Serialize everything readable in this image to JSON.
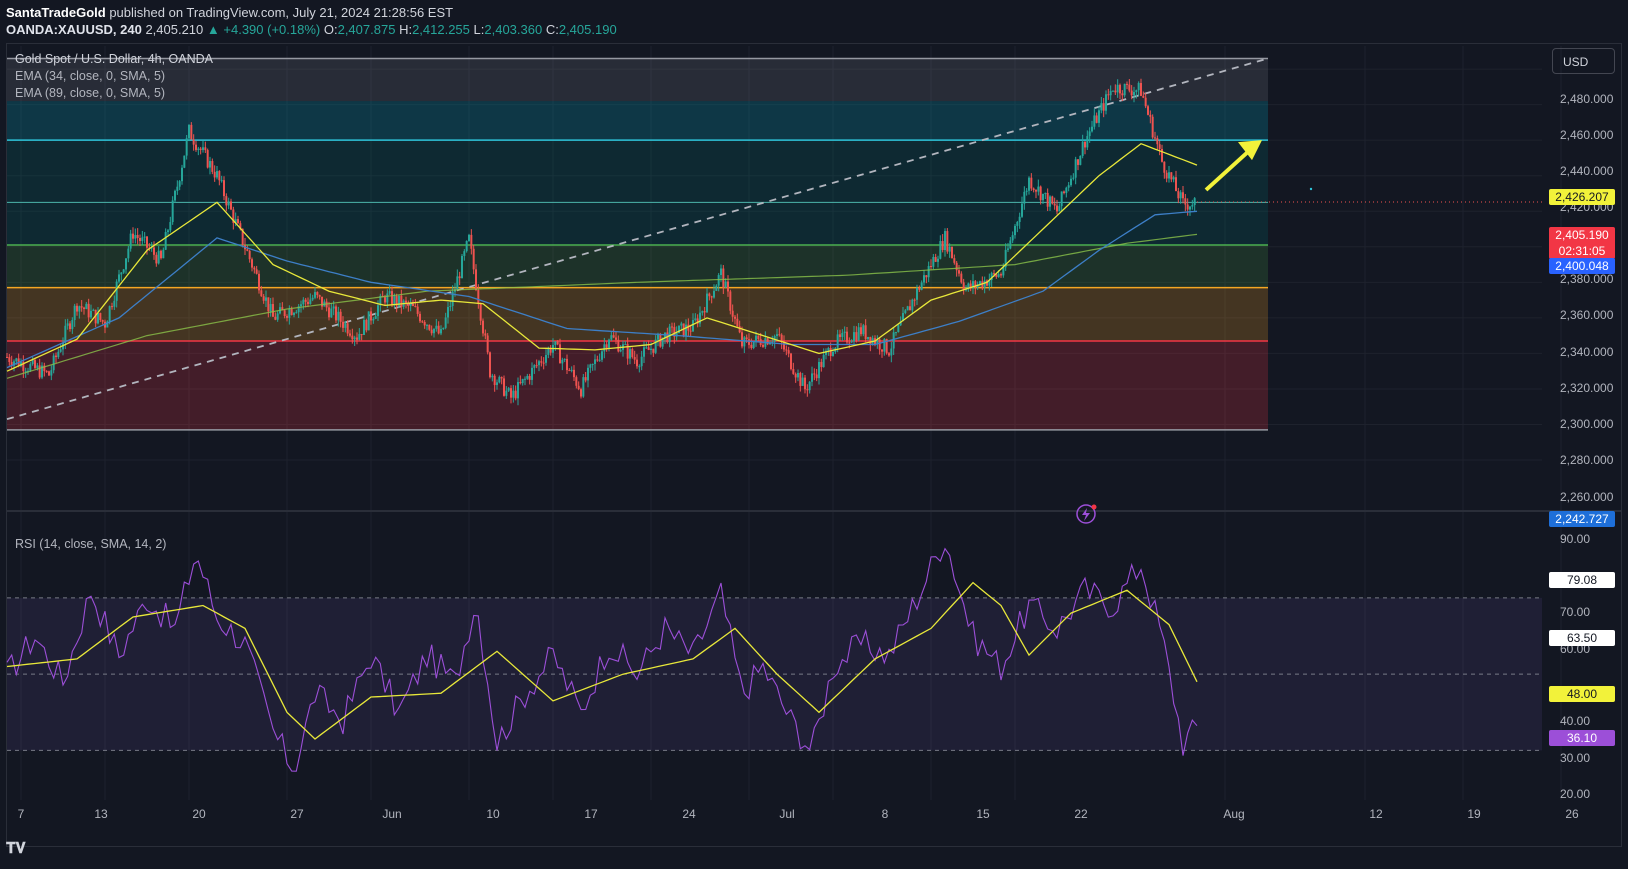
{
  "header": {
    "author": "SantaTradeGold",
    "published_text": "published on TradingView.com, July 21, 2024 21:28:56 EST",
    "symbol": "OANDA:XAUUSD, 240",
    "price": "2,405.210",
    "change": "▲ +4.390 (+0.18%)",
    "o_label": "O:",
    "o_value": "2,407.875",
    "h_label": "H:",
    "h_value": "2,412.255",
    "l_label": "L:",
    "l_value": "2,403.360",
    "c_label": "C:",
    "c_value": "2,405.190"
  },
  "legend": {
    "title": "Gold Spot / U.S. Dollar, 4h, OANDA",
    "ema1": "EMA (34, close, 0, SMA, 5)",
    "ema2": "EMA (89, close, 0, SMA, 5)",
    "rsi": "RSI (14, close, SMA, 14, 2)"
  },
  "currency_button": "USD",
  "price_axis_labels": [
    "2,480.000",
    "2,460.000",
    "2,440.000",
    "2,420.000",
    "2,380.000",
    "2,360.000",
    "2,340.000",
    "2,320.000",
    "2,300.000",
    "2,280.000",
    "2,260.000"
  ],
  "rsi_axis_labels": [
    "90.00",
    "70.00",
    "60.00",
    "40.00",
    "30.00",
    "20.00"
  ],
  "price_tags": {
    "ema34": "2,426.207",
    "last": "2,405.190",
    "countdown": "02:31:05",
    "ema89": "2,400.048",
    "low_marker": "2,242.727"
  },
  "rsi_tags": {
    "upper": "79.08",
    "mid_high": "63.50",
    "signal": "48.00",
    "rsi": "36.10"
  },
  "time_labels": [
    "7",
    "13",
    "20",
    "27",
    "Jun",
    "10",
    "17",
    "24",
    "Jul",
    "8",
    "15",
    "22",
    "Aug",
    "12",
    "19",
    "26"
  ],
  "colors": {
    "background": "#131722",
    "up": "#26a69a",
    "down": "#ef5350",
    "ema34": "#e8e83a",
    "ema89": "#3d7fc7",
    "ema_long": "#8bc34a",
    "zone_top_line": "#2ec4d9",
    "zone_mid_line": "#4caf50",
    "zone_orange_line": "#f5a623",
    "zone_red_line": "#f23645",
    "rsi_line": "#9c4fd8",
    "rsi_signal": "#e8e83a",
    "arrow": "#f2f23a"
  },
  "chart_data": [
    {
      "type": "candlestick",
      "title": "Gold Spot / U.S. Dollar, 4h, OANDA",
      "ylim": [
        2233,
        2493
      ],
      "x_range_days": [
        "May 6",
        "Aug 26"
      ],
      "zones": [
        {
          "from": 2462,
          "to": 2486,
          "color": "gray"
        },
        {
          "from": 2440,
          "to": 2462,
          "color": "teal"
        },
        {
          "from": 2381,
          "to": 2440,
          "color": "dark teal"
        },
        {
          "from": 2357,
          "to": 2381,
          "color": "green"
        },
        {
          "from": 2327,
          "to": 2357,
          "color": "orange"
        },
        {
          "from": 2277,
          "to": 2327,
          "color": "red"
        }
      ],
      "trendline": {
        "start": {
          "date": "May 6",
          "value": 2283
        },
        "end": {
          "date": "Aug 4",
          "value": 2486
        }
      },
      "close_path": [
        {
          "day": 0,
          "v": 2318
        },
        {
          "day": 3,
          "v": 2308
        },
        {
          "day": 5,
          "v": 2348
        },
        {
          "day": 7,
          "v": 2337
        },
        {
          "day": 9,
          "v": 2388
        },
        {
          "day": 11,
          "v": 2372
        },
        {
          "day": 13,
          "v": 2445
        },
        {
          "day": 15,
          "v": 2420
        },
        {
          "day": 17,
          "v": 2380
        },
        {
          "day": 19,
          "v": 2340
        },
        {
          "day": 22,
          "v": 2352
        },
        {
          "day": 25,
          "v": 2330
        },
        {
          "day": 27,
          "v": 2352
        },
        {
          "day": 29,
          "v": 2345
        },
        {
          "day": 31,
          "v": 2330
        },
        {
          "day": 33,
          "v": 2384
        },
        {
          "day": 34.5,
          "v": 2310
        },
        {
          "day": 36,
          "v": 2295
        },
        {
          "day": 39,
          "v": 2325
        },
        {
          "day": 41,
          "v": 2300
        },
        {
          "day": 43,
          "v": 2330
        },
        {
          "day": 45,
          "v": 2316
        },
        {
          "day": 47,
          "v": 2330
        },
        {
          "day": 49,
          "v": 2335
        },
        {
          "day": 51,
          "v": 2365
        },
        {
          "day": 52.5,
          "v": 2325
        },
        {
          "day": 55,
          "v": 2330
        },
        {
          "day": 57,
          "v": 2300
        },
        {
          "day": 59,
          "v": 2325
        },
        {
          "day": 61,
          "v": 2333
        },
        {
          "day": 63,
          "v": 2322
        },
        {
          "day": 65,
          "v": 2355
        },
        {
          "day": 67,
          "v": 2385
        },
        {
          "day": 68.5,
          "v": 2356
        },
        {
          "day": 71,
          "v": 2365
        },
        {
          "day": 73,
          "v": 2418
        },
        {
          "day": 75,
          "v": 2400
        },
        {
          "day": 77,
          "v": 2440
        },
        {
          "day": 79,
          "v": 2470
        },
        {
          "day": 81,
          "v": 2468
        },
        {
          "day": 82.5,
          "v": 2428
        },
        {
          "day": 84,
          "v": 2404
        },
        {
          "day": 85,
          "v": 2405
        }
      ],
      "ema34_path": [
        {
          "day": 0,
          "v": 2310
        },
        {
          "day": 5,
          "v": 2328
        },
        {
          "day": 10,
          "v": 2378
        },
        {
          "day": 15,
          "v": 2405
        },
        {
          "day": 19,
          "v": 2370
        },
        {
          "day": 23,
          "v": 2355
        },
        {
          "day": 27,
          "v": 2347
        },
        {
          "day": 31,
          "v": 2350
        },
        {
          "day": 34,
          "v": 2348
        },
        {
          "day": 38,
          "v": 2323
        },
        {
          "day": 42,
          "v": 2322
        },
        {
          "day": 46,
          "v": 2325
        },
        {
          "day": 50,
          "v": 2340
        },
        {
          "day": 54,
          "v": 2330
        },
        {
          "day": 58,
          "v": 2320
        },
        {
          "day": 62,
          "v": 2327
        },
        {
          "day": 66,
          "v": 2350
        },
        {
          "day": 70,
          "v": 2360
        },
        {
          "day": 74,
          "v": 2390
        },
        {
          "day": 78,
          "v": 2420
        },
        {
          "day": 81,
          "v": 2438
        },
        {
          "day": 83,
          "v": 2432
        },
        {
          "day": 85,
          "v": 2426
        }
      ],
      "ema89_path": [
        {
          "day": 0,
          "v": 2312
        },
        {
          "day": 8,
          "v": 2340
        },
        {
          "day": 15,
          "v": 2385
        },
        {
          "day": 20,
          "v": 2372
        },
        {
          "day": 26,
          "v": 2360
        },
        {
          "day": 33,
          "v": 2352
        },
        {
          "day": 40,
          "v": 2334
        },
        {
          "day": 48,
          "v": 2330
        },
        {
          "day": 56,
          "v": 2325
        },
        {
          "day": 62,
          "v": 2325
        },
        {
          "day": 68,
          "v": 2338
        },
        {
          "day": 74,
          "v": 2355
        },
        {
          "day": 78,
          "v": 2378
        },
        {
          "day": 82,
          "v": 2398
        },
        {
          "day": 85,
          "v": 2400
        }
      ],
      "ema_long_path": [
        {
          "day": 0,
          "v": 2306
        },
        {
          "day": 10,
          "v": 2330
        },
        {
          "day": 20,
          "v": 2345
        },
        {
          "day": 30,
          "v": 2355
        },
        {
          "day": 45,
          "v": 2360
        },
        {
          "day": 60,
          "v": 2364
        },
        {
          "day": 72,
          "v": 2370
        },
        {
          "day": 80,
          "v": 2382
        },
        {
          "day": 85,
          "v": 2387
        }
      ],
      "arrow": {
        "from": {
          "day": 86,
          "v": 2412
        },
        "to": {
          "day": 90,
          "v": 2440
        }
      }
    },
    {
      "type": "line",
      "title": "RSI (14, close, SMA, 14, 2)",
      "ylim": [
        17,
        92
      ],
      "bands": [
        70,
        50,
        30
      ],
      "rsi_path": [
        {
          "day": 0,
          "v": 50
        },
        {
          "day": 2,
          "v": 60
        },
        {
          "day": 4,
          "v": 48
        },
        {
          "day": 6,
          "v": 72
        },
        {
          "day": 8,
          "v": 55
        },
        {
          "day": 10,
          "v": 70
        },
        {
          "day": 12,
          "v": 62
        },
        {
          "day": 13.5,
          "v": 82
        },
        {
          "day": 15,
          "v": 65
        },
        {
          "day": 17,
          "v": 58
        },
        {
          "day": 19,
          "v": 35
        },
        {
          "day": 20.5,
          "v": 25
        },
        {
          "day": 22,
          "v": 45
        },
        {
          "day": 24,
          "v": 38
        },
        {
          "day": 26,
          "v": 55
        },
        {
          "day": 28,
          "v": 40
        },
        {
          "day": 30,
          "v": 55
        },
        {
          "day": 32,
          "v": 48
        },
        {
          "day": 33.5,
          "v": 70
        },
        {
          "day": 35,
          "v": 32
        },
        {
          "day": 37,
          "v": 45
        },
        {
          "day": 39,
          "v": 55
        },
        {
          "day": 41,
          "v": 40
        },
        {
          "day": 43,
          "v": 58
        },
        {
          "day": 45,
          "v": 50
        },
        {
          "day": 47,
          "v": 62
        },
        {
          "day": 49,
          "v": 55
        },
        {
          "day": 51,
          "v": 71
        },
        {
          "day": 52.5,
          "v": 45
        },
        {
          "day": 54,
          "v": 52
        },
        {
          "day": 56,
          "v": 38
        },
        {
          "day": 57.5,
          "v": 30
        },
        {
          "day": 59,
          "v": 52
        },
        {
          "day": 61,
          "v": 58
        },
        {
          "day": 63,
          "v": 55
        },
        {
          "day": 65,
          "v": 70
        },
        {
          "day": 67,
          "v": 86
        },
        {
          "day": 69,
          "v": 60
        },
        {
          "day": 71,
          "v": 52
        },
        {
          "day": 73,
          "v": 68
        },
        {
          "day": 75,
          "v": 62
        },
        {
          "day": 77,
          "v": 72
        },
        {
          "day": 79,
          "v": 68
        },
        {
          "day": 81,
          "v": 79
        },
        {
          "day": 82.5,
          "v": 60
        },
        {
          "day": 84,
          "v": 32
        },
        {
          "day": 85,
          "v": 36
        }
      ],
      "signal_path": [
        {
          "day": 0,
          "v": 52
        },
        {
          "day": 5,
          "v": 54
        },
        {
          "day": 9,
          "v": 65
        },
        {
          "day": 14,
          "v": 68
        },
        {
          "day": 17,
          "v": 62
        },
        {
          "day": 20,
          "v": 40
        },
        {
          "day": 22,
          "v": 33
        },
        {
          "day": 26,
          "v": 44
        },
        {
          "day": 31,
          "v": 45
        },
        {
          "day": 35,
          "v": 56
        },
        {
          "day": 39,
          "v": 43
        },
        {
          "day": 44,
          "v": 50
        },
        {
          "day": 49,
          "v": 54
        },
        {
          "day": 52,
          "v": 62
        },
        {
          "day": 55,
          "v": 50
        },
        {
          "day": 58,
          "v": 40
        },
        {
          "day": 62,
          "v": 54
        },
        {
          "day": 66,
          "v": 62
        },
        {
          "day": 69,
          "v": 74
        },
        {
          "day": 71,
          "v": 68
        },
        {
          "day": 73,
          "v": 55
        },
        {
          "day": 76,
          "v": 66
        },
        {
          "day": 80,
          "v": 72
        },
        {
          "day": 83,
          "v": 63
        },
        {
          "day": 85,
          "v": 48
        }
      ]
    }
  ]
}
